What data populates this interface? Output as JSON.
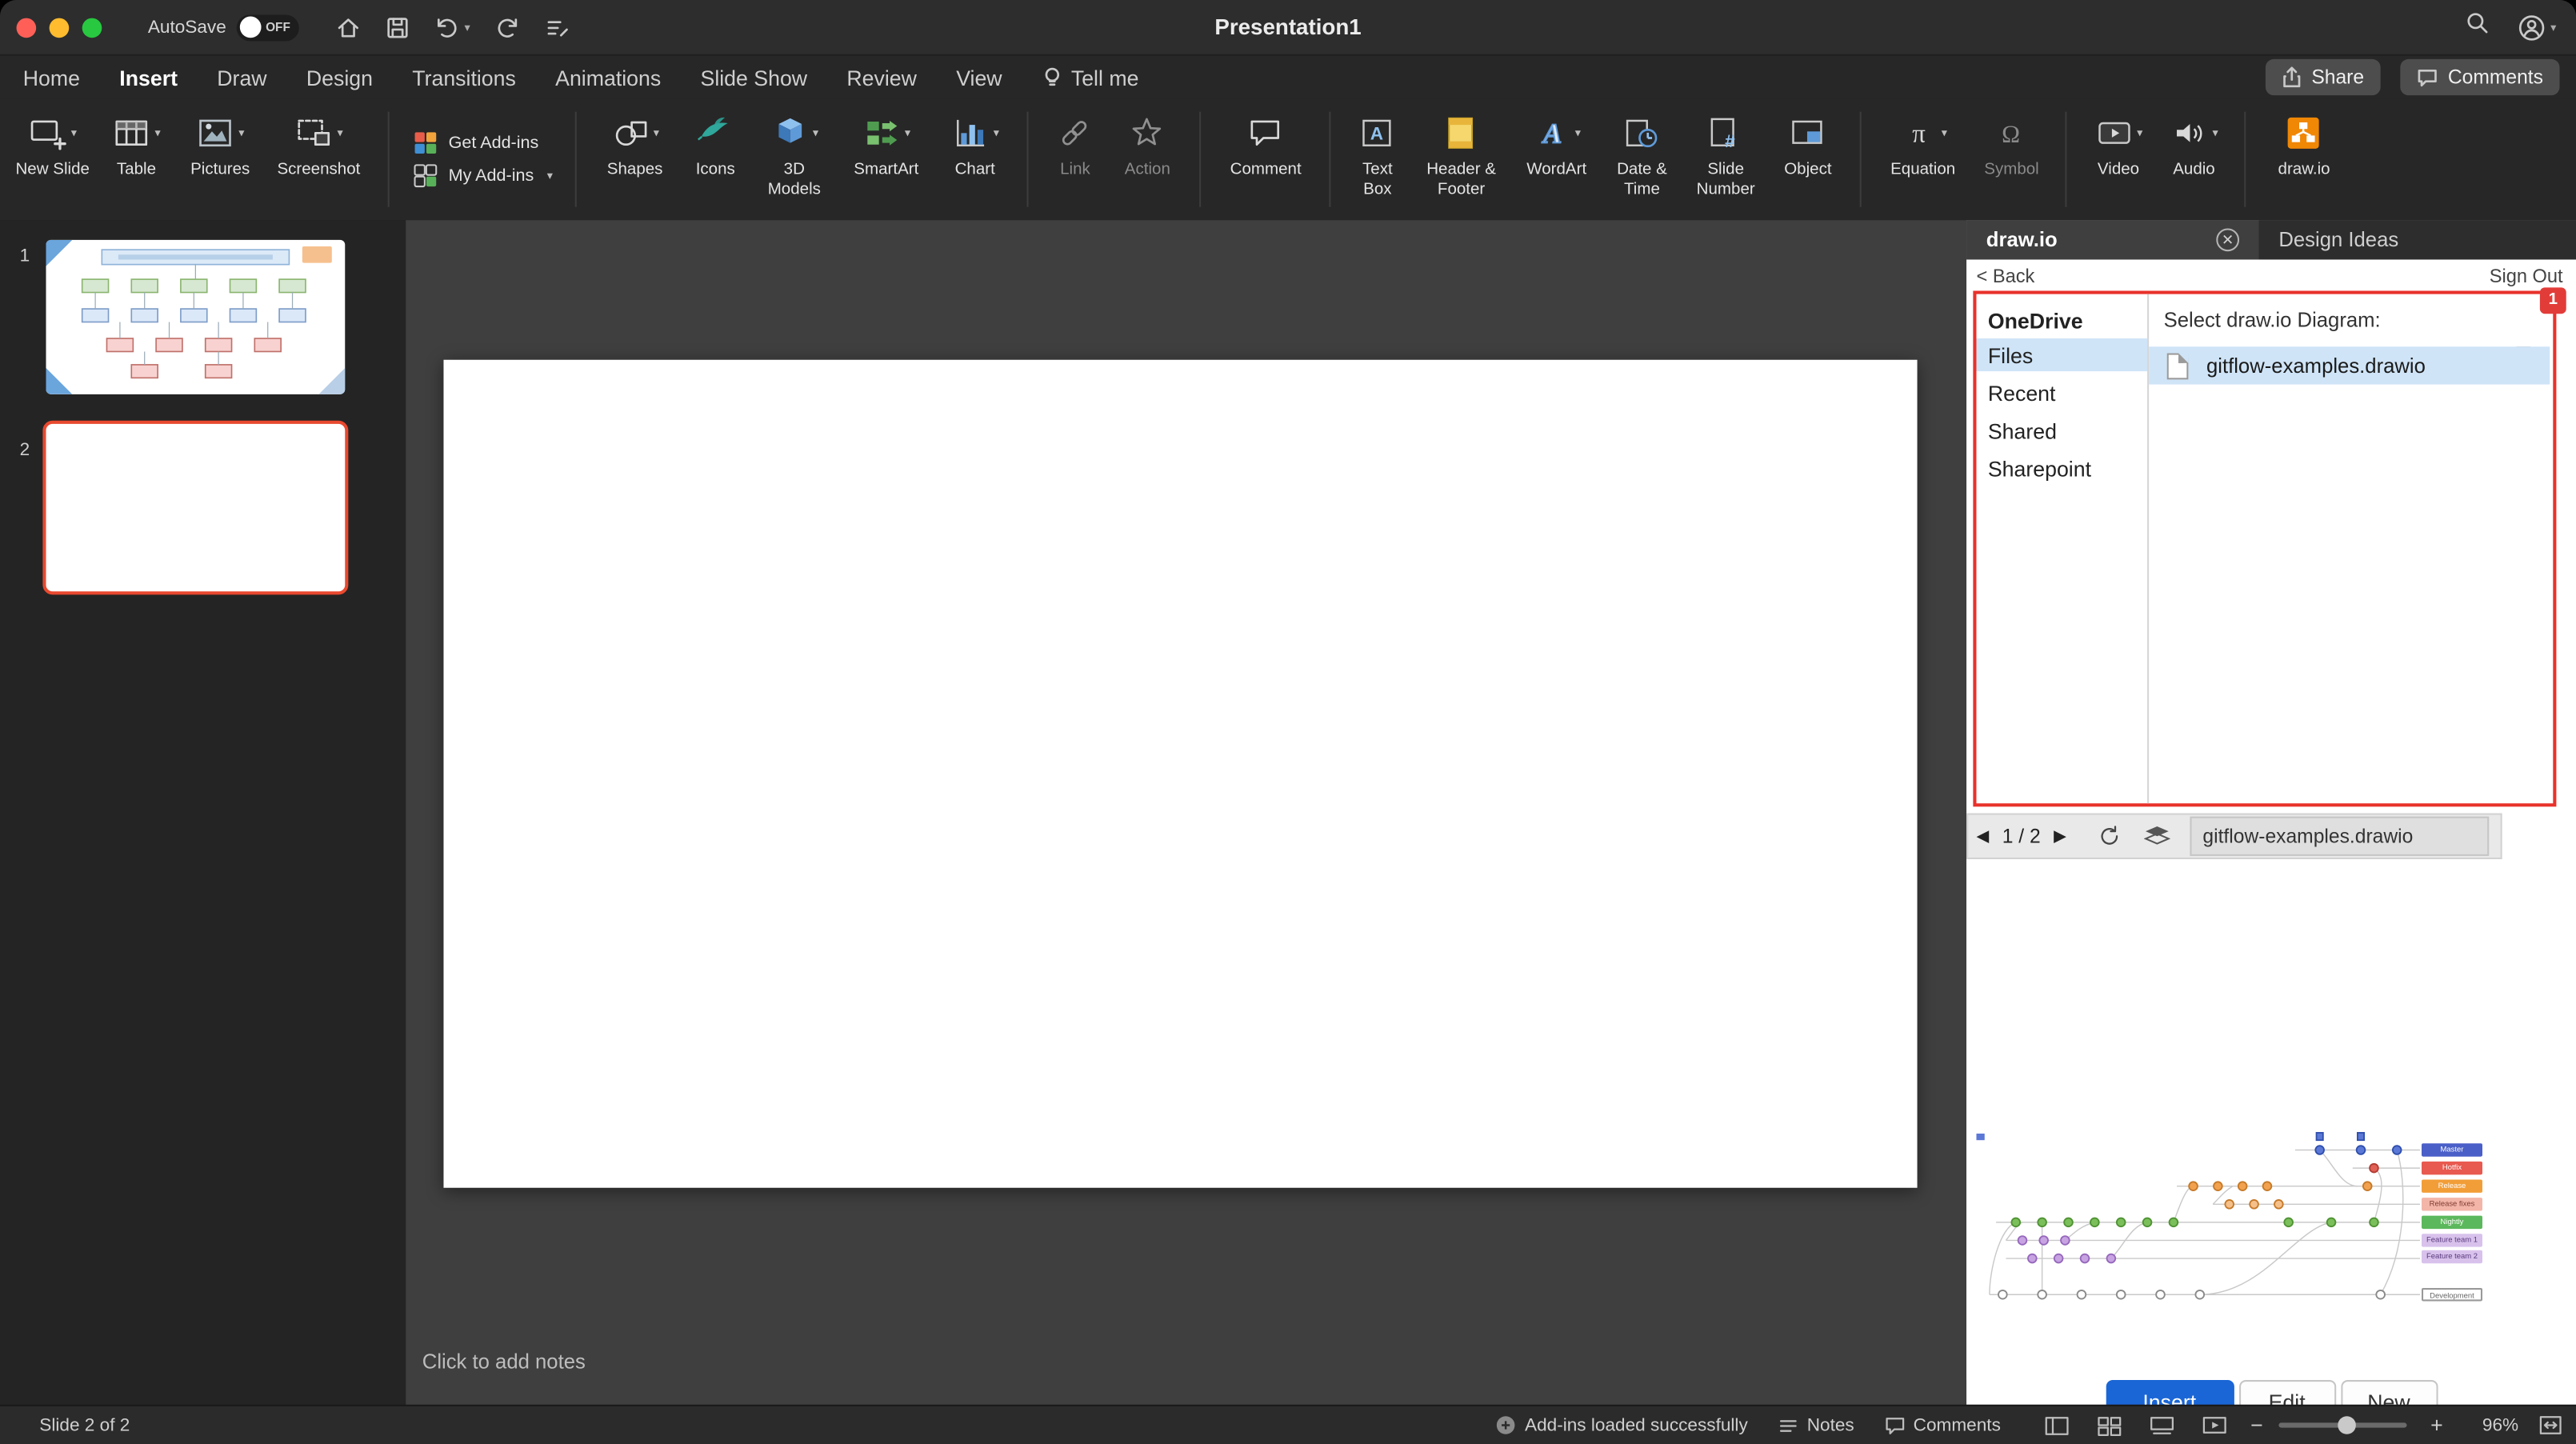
{
  "window": {
    "title": "Presentation1",
    "autosave_label": "AutoSave",
    "autosave_state": "OFF"
  },
  "menubar_tabs": {
    "items": [
      {
        "label": "Home"
      },
      {
        "label": "Insert"
      },
      {
        "label": "Draw"
      },
      {
        "label": "Design"
      },
      {
        "label": "Transitions"
      },
      {
        "label": "Animations"
      },
      {
        "label": "Slide Show"
      },
      {
        "label": "Review"
      },
      {
        "label": "View"
      }
    ],
    "active_tab": "Insert",
    "tell_me_label": "Tell me",
    "share_label": "Share",
    "comments_label": "Comments"
  },
  "ribbon": {
    "items": [
      {
        "label": "New Slide"
      },
      {
        "label": "Table"
      },
      {
        "label": "Pictures"
      },
      {
        "label": "Screenshot"
      },
      {
        "label": "Get Add-ins"
      },
      {
        "label": "My Add-ins"
      },
      {
        "label": "Shapes"
      },
      {
        "label": "Icons"
      },
      {
        "label": "3D Models"
      },
      {
        "label": "SmartArt"
      },
      {
        "label": "Chart"
      },
      {
        "label": "Link"
      },
      {
        "label": "Action"
      },
      {
        "label": "Comment"
      },
      {
        "label": "Text Box"
      },
      {
        "label": "Header & Footer"
      },
      {
        "label": "WordArt"
      },
      {
        "label": "Date & Time"
      },
      {
        "label": "Slide Number"
      },
      {
        "label": "Object"
      },
      {
        "label": "Equation"
      },
      {
        "label": "Symbol"
      },
      {
        "label": "Video"
      },
      {
        "label": "Audio"
      },
      {
        "label": "draw.io"
      }
    ]
  },
  "slide_panel": {
    "slides": [
      {
        "number": "1"
      },
      {
        "number": "2"
      }
    ],
    "selected_slide": "2"
  },
  "editor": {
    "notes_placeholder": "Click to add notes"
  },
  "addin_panel": {
    "tabs": {
      "drawio": "draw.io",
      "design_ideas": "Design Ideas"
    },
    "back_link": "< Back",
    "signout_link": "Sign Out",
    "notification_badge": "1",
    "file_browser": {
      "source_header": "OneDrive",
      "nav_items": [
        {
          "label": "Files"
        },
        {
          "label": "Recent"
        },
        {
          "label": "Shared"
        },
        {
          "label": "Sharepoint"
        }
      ],
      "selected_nav": "Files",
      "picker_title": "Select draw.io Diagram:",
      "files": [
        {
          "name": "gitflow-examples.drawio"
        }
      ],
      "selected_file": "gitflow-examples.drawio"
    },
    "preview_bar": {
      "page_indicator": "1 / 2",
      "file_label": "gitflow-examples.drawio"
    },
    "preview_diagram": {
      "branch_labels": [
        {
          "text": "Master",
          "bg": "#4a5fc8",
          "fg": "#ffffff"
        },
        {
          "text": "Hotfix",
          "bg": "#e8594f",
          "fg": "#ffffff"
        },
        {
          "text": "Release",
          "bg": "#f29e38",
          "fg": "#ffffff"
        },
        {
          "text": "Release fixes",
          "bg": "#f2b5a8",
          "fg": "#833c32"
        },
        {
          "text": "Nightly",
          "bg": "#5cb85c",
          "fg": "#ffffff"
        },
        {
          "text": "Feature team 1",
          "bg": "#d8c2ec",
          "fg": "#5a3a7e"
        },
        {
          "text": "Feature team 2",
          "bg": "#d8c2ec",
          "fg": "#5a3a7e"
        },
        {
          "text": "Development",
          "bg": "#ffffff",
          "fg": "#666666"
        }
      ]
    },
    "actions": {
      "insert": "Insert",
      "edit": "Edit",
      "new": "New"
    }
  },
  "statusbar": {
    "slide_indicator": "Slide 2 of 2",
    "addin_status": "Add-ins loaded successfully",
    "notes_label": "Notes",
    "comments_label": "Comments",
    "zoom_level": "96%"
  },
  "colors": {
    "selected_slide_border": "#e8492f",
    "addin_highlight_border": "#e8322b",
    "selection_blue": "#cfe4f7",
    "insert_button": "#1a66d6",
    "drawio_orange": "#f08705"
  }
}
